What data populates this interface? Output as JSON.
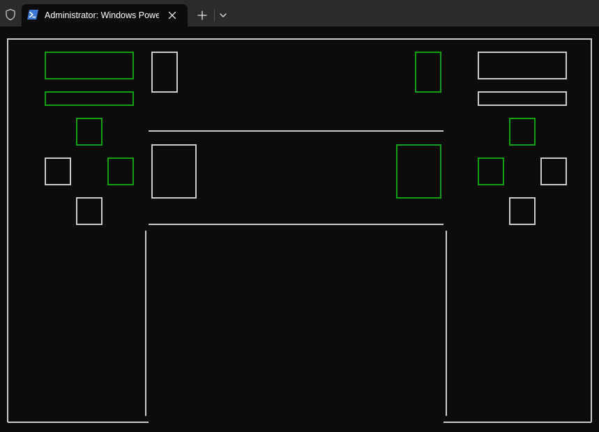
{
  "window": {
    "tab_title": "Administrator: Windows PowerShell"
  },
  "icons": {
    "shield": "shield-icon",
    "powershell": "powershell-icon",
    "close": "close-icon",
    "new_tab": "plus-icon",
    "dropdown": "chevron-down-icon"
  },
  "colors": {
    "titlebar": "#2b2b2b",
    "terminal_bg": "#0c0c0c",
    "line_white": "#cccccc",
    "line_green": "#13a10e",
    "ps_blue": "#3a78d4"
  }
}
